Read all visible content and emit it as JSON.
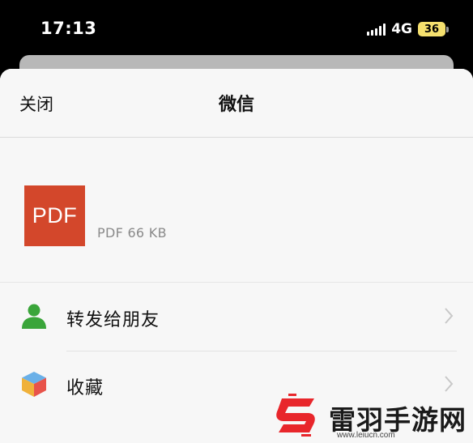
{
  "status_bar": {
    "time": "17:13",
    "network": "4G",
    "battery": "36"
  },
  "sheet": {
    "close_label": "关闭",
    "title": "微信"
  },
  "file": {
    "thumbnail_text": "PDF",
    "meta": "PDF 66 KB"
  },
  "actions": [
    {
      "label": "转发给朋友",
      "icon": "person-icon"
    },
    {
      "label": "收藏",
      "icon": "cube-icon"
    }
  ],
  "watermark": {
    "brand": "雷羽手游网",
    "url": "www.leiucn.com"
  },
  "colors": {
    "pdf_red": "#d3472b",
    "battery_yellow": "#f5e06e",
    "person_green": "#3aa53a",
    "watermark_red": "#e8262b"
  }
}
